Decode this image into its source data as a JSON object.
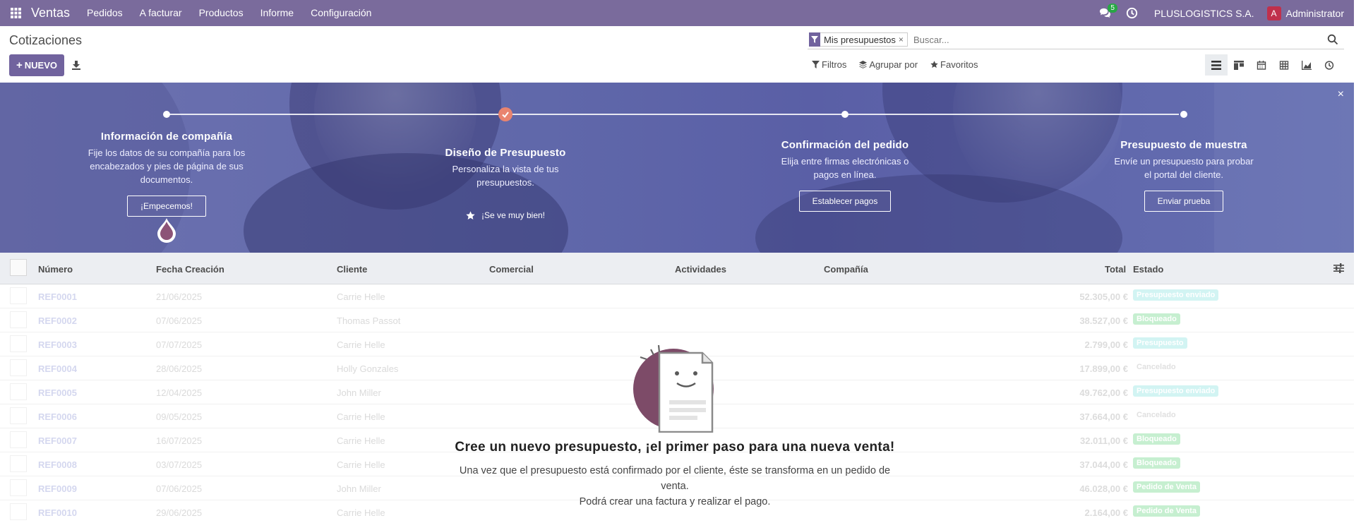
{
  "navbar": {
    "app_name": "Ventas",
    "menu": [
      "Pedidos",
      "A facturar",
      "Productos",
      "Informe",
      "Configuración"
    ],
    "chat_count": "5",
    "company": "PLUSLOGISTICS S.A.",
    "user": {
      "avatar_letter": "A",
      "name": "Administrator"
    }
  },
  "control_panel": {
    "title": "Cotizaciones",
    "new_button": "NUEVO",
    "search": {
      "facet_label": "Mis presupuestos",
      "facet_close": "×",
      "placeholder": "Buscar..."
    },
    "filters_label": "Filtros",
    "groupby_label": "Agrupar por",
    "favorites_label": "Favoritos",
    "views": [
      "list-view-icon",
      "kanban-view-icon",
      "calendar-view-icon",
      "pivot-view-icon",
      "graph-view-icon",
      "activity-view-icon"
    ]
  },
  "onboarding": {
    "close": "×",
    "steps": [
      {
        "title": "Información de compañía",
        "description": "Fije los datos de su compañía para los encabezados y pies de página de sus documentos.",
        "button": "¡Empecemos!",
        "done": false
      },
      {
        "title": "Diseño de Presupuesto",
        "description": "Personaliza la vista de tus presupuestos.",
        "done_message": "¡Se ve muy bien!",
        "done": true
      },
      {
        "title": "Confirmación del pedido",
        "description": "Elija entre firmas electrónicas o pagos en línea.",
        "button": "Establecer pagos",
        "done": false
      },
      {
        "title": "Presupuesto de muestra",
        "description": "Envíe un presupuesto para probar el portal del cliente.",
        "button": "Enviar prueba",
        "done": false
      }
    ]
  },
  "table": {
    "columns": {
      "number": "Número",
      "date": "Fecha Creación",
      "customer": "Cliente",
      "salesperson": "Comercial",
      "activities": "Actividades",
      "company": "Compañía",
      "total": "Total",
      "status": "Estado"
    },
    "rows": [
      {
        "ref": "REF0001",
        "date": "21/06/2025",
        "customer": "Carrie Helle",
        "total": "52.305,00 €",
        "status": "Presupuesto enviado",
        "status_kind": "sent"
      },
      {
        "ref": "REF0002",
        "date": "07/06/2025",
        "customer": "Thomas Passot",
        "total": "38.527,00 €",
        "status": "Bloqueado",
        "status_kind": "locked"
      },
      {
        "ref": "REF0003",
        "date": "07/07/2025",
        "customer": "Carrie Helle",
        "total": "2.799,00 €",
        "status": "Presupuesto",
        "status_kind": "draft"
      },
      {
        "ref": "REF0004",
        "date": "28/06/2025",
        "customer": "Holly Gonzales",
        "total": "17.899,00 €",
        "status": "Cancelado",
        "status_kind": "cancel"
      },
      {
        "ref": "REF0005",
        "date": "12/04/2025",
        "customer": "John Miller",
        "total": "49.762,00 €",
        "status": "Presupuesto enviado",
        "status_kind": "sent"
      },
      {
        "ref": "REF0006",
        "date": "09/05/2025",
        "customer": "Carrie Helle",
        "total": "37.664,00 €",
        "status": "Cancelado",
        "status_kind": "cancel"
      },
      {
        "ref": "REF0007",
        "date": "16/07/2025",
        "customer": "Carrie Helle",
        "total": "32.011,00 €",
        "status": "Bloqueado",
        "status_kind": "locked"
      },
      {
        "ref": "REF0008",
        "date": "03/07/2025",
        "customer": "Carrie Helle",
        "total": "37.044,00 €",
        "status": "Bloqueado",
        "status_kind": "locked"
      },
      {
        "ref": "REF0009",
        "date": "07/06/2025",
        "customer": "John Miller",
        "total": "46.028,00 €",
        "status": "Pedido de Venta",
        "status_kind": "sale"
      },
      {
        "ref": "REF0010",
        "date": "29/06/2025",
        "customer": "Carrie Helle",
        "total": "2.164,00 €",
        "status": "Pedido de Venta",
        "status_kind": "sale"
      }
    ]
  },
  "status_colors": {
    "sent": {
      "bg": "#d2f4f3",
      "fg": "#ffffff"
    },
    "locked": {
      "bg": "#c6efd0",
      "fg": "#ffffff"
    },
    "draft": {
      "bg": "#d2f4f3",
      "fg": "#ffffff"
    },
    "cancel": {
      "bg": "#ffffff",
      "fg": "#e0e0e0"
    },
    "sale": {
      "bg": "#c6efd0",
      "fg": "#ffffff"
    }
  },
  "empty_helper": {
    "title": "Cree un nuevo presupuesto, ¡el primer paso para una nueva venta!",
    "body_line1": "Una vez que el presupuesto está confirmado por el cliente, éste se transforma en un pedido de venta.",
    "body_line2": "Podrá crear una factura y realizar el pago."
  },
  "colors": {
    "navbar": "#7a6b9c",
    "primary": "#71639e",
    "banner": "#6068aa",
    "step_done": "#e9846f"
  }
}
